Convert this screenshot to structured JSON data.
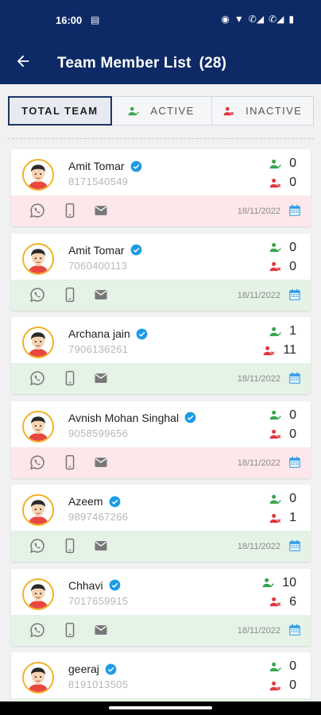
{
  "status_bar": {
    "time": "16:00"
  },
  "header": {
    "title": "Team Member List",
    "count": "(28)"
  },
  "tabs": [
    {
      "label": "TOTAL TEAM",
      "selected": true
    },
    {
      "label": "ACTIVE",
      "icon": "user-active-icon"
    },
    {
      "label": "INACTIVE",
      "icon": "user-inactive-icon"
    }
  ],
  "colors": {
    "brand": "#0d2a66",
    "active": "#3aa64a",
    "inactive": "#e0373f",
    "pink_row": "#fde7ea",
    "green_row": "#e5f2e6",
    "verified": "#1e9be6",
    "calendar": "#2e9be8"
  },
  "members": [
    {
      "name": "Amit Tomar",
      "phone": "8171540549",
      "active": "0",
      "inactive": "0",
      "date": "18/11/2022",
      "status": "pink"
    },
    {
      "name": "Amit Tomar",
      "phone": "7060400113",
      "active": "0",
      "inactive": "0",
      "date": "18/11/2022",
      "status": "green"
    },
    {
      "name": "Archana jain",
      "phone": "7906136261",
      "active": "1",
      "inactive": "11",
      "date": "18/11/2022",
      "status": "green"
    },
    {
      "name": "Avnish Mohan Singhal",
      "phone": "9058599656",
      "active": "0",
      "inactive": "0",
      "date": "18/11/2022",
      "status": "pink"
    },
    {
      "name": "Azeem",
      "phone": "9897467266",
      "active": "0",
      "inactive": "1",
      "date": "18/11/2022",
      "status": "green"
    },
    {
      "name": "Chhavi",
      "phone": "7017659915",
      "active": "10",
      "inactive": "6",
      "date": "18/11/2022",
      "status": "green"
    },
    {
      "name": "geeraj",
      "phone": "8191013505",
      "active": "0",
      "inactive": "0",
      "date": "",
      "status": "green"
    }
  ]
}
